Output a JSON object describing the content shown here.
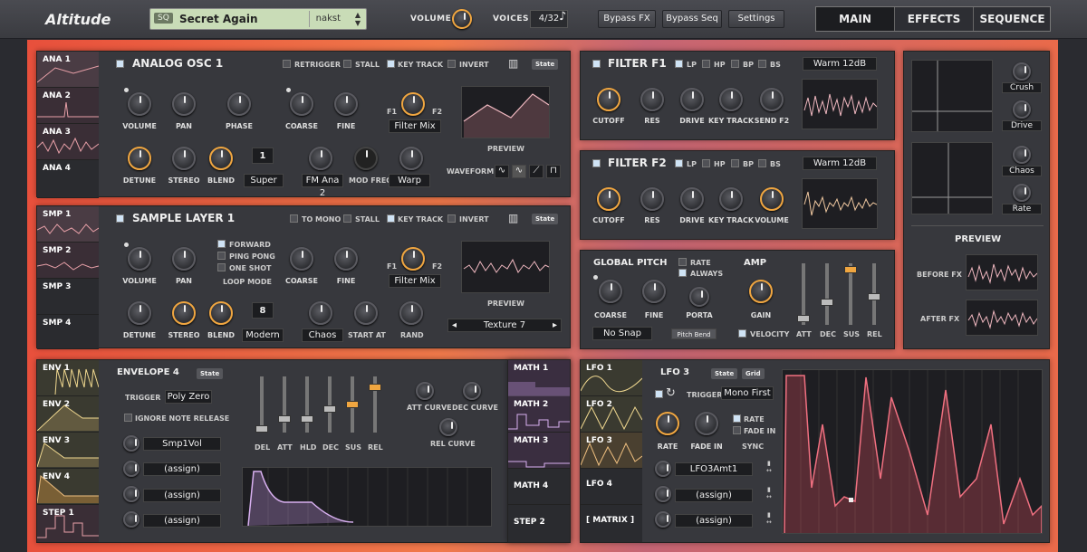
{
  "app": {
    "title": "Altitude"
  },
  "preset": {
    "badge": "SQ",
    "name": "Secret Again",
    "author": "nakst"
  },
  "header": {
    "volume_label": "VOLUME",
    "voices_label": "VOICES",
    "voices_value": "4/32",
    "bypass_fx": "Bypass FX",
    "bypass_seq": "Bypass Seq",
    "settings": "Settings"
  },
  "tabs": [
    {
      "label": "MAIN",
      "active": true
    },
    {
      "label": "EFFECTS"
    },
    {
      "label": "SEQUENCE"
    }
  ],
  "colors": {
    "accent": "#f0a640",
    "bg_gradient_start": "#e8503c",
    "bg_gradient_end": "#ea6a4a",
    "panel": "#37383d",
    "wave": "#e8a0a8"
  },
  "osc": {
    "tabs": [
      "ANA 1",
      "ANA 2",
      "ANA 3",
      "ANA 4"
    ],
    "title": "ANALOG OSC 1",
    "toggles": [
      "RETRIGGER",
      "STALL",
      "KEY TRACK",
      "INVERT"
    ],
    "state": "State",
    "knobs1": [
      "VOLUME",
      "PAN",
      "PHASE",
      "COARSE",
      "FINE"
    ],
    "knobs2": [
      "DETUNE",
      "STEREO",
      "BLEND"
    ],
    "unison": "1",
    "unison_mode": "Super",
    "fm": "FM Ana 2",
    "mod_freq": "MOD FREQ",
    "warp": "Warp",
    "f1": "F1",
    "f2": "F2",
    "filter_mix": "Filter Mix",
    "preview": "PREVIEW",
    "waveform": "WAVEFORM"
  },
  "smp": {
    "tabs": [
      "SMP 1",
      "SMP 2",
      "SMP 3",
      "SMP 4"
    ],
    "title": "SAMPLE LAYER 1",
    "toggles": [
      "TO MONO",
      "STALL",
      "KEY TRACK",
      "INVERT"
    ],
    "state": "State",
    "knobs1": [
      "VOLUME",
      "PAN"
    ],
    "loop": [
      "FORWARD",
      "PING PONG",
      "ONE SHOT"
    ],
    "loop_label": "LOOP MODE",
    "knobs1b": [
      "COARSE",
      "FINE"
    ],
    "knobs2": [
      "DETUNE",
      "STEREO",
      "BLEND"
    ],
    "unison": "8",
    "unison_mode": "Modern",
    "chaos": "Chaos",
    "start_at": "START AT",
    "rand": "RAND",
    "f1": "F1",
    "f2": "F2",
    "filter_mix": "Filter Mix",
    "preview": "PREVIEW",
    "sample": "Texture 7"
  },
  "filter1": {
    "title": "FILTER F1",
    "modes": [
      "LP",
      "HP",
      "BP",
      "BS"
    ],
    "type": "Warm 12dB",
    "knobs": [
      "CUTOFF",
      "RES",
      "DRIVE",
      "KEY TRACK",
      "SEND F2"
    ]
  },
  "filter2": {
    "title": "FILTER F2",
    "modes": [
      "LP",
      "HP",
      "BP",
      "BS"
    ],
    "type": "Warm 12dB",
    "knobs": [
      "CUTOFF",
      "RES",
      "DRIVE",
      "KEY TRACK",
      "VOLUME"
    ]
  },
  "fx": {
    "labels": [
      "Crush",
      "Drive",
      "Chaos",
      "Rate"
    ],
    "preview": "PREVIEW",
    "before": "BEFORE FX",
    "after": "AFTER FX"
  },
  "pitch": {
    "title": "GLOBAL PITCH",
    "rate": "RATE",
    "always": "ALWAYS",
    "knobs": [
      "COARSE",
      "FINE",
      "PORTA"
    ],
    "snap": "No Snap",
    "pitch_bend": "Pitch Bend"
  },
  "amp": {
    "title": "AMP",
    "gain": "GAIN",
    "velocity": "VELOCITY",
    "faders": [
      {
        "label": "ATT",
        "value": 0.05
      },
      {
        "label": "DEC",
        "value": 0.35
      },
      {
        "label": "SUS",
        "value": 0.95
      },
      {
        "label": "REL",
        "value": 0.45
      }
    ]
  },
  "env": {
    "tabs": [
      "ENV 1",
      "ENV 2",
      "ENV 3",
      "ENV 4",
      "STEP 1"
    ],
    "title": "ENVELOPE 4",
    "state": "State",
    "trigger_label": "TRIGGER",
    "trigger": "Poly Zero",
    "ignore": "IGNORE NOTE RELEASE",
    "assign": [
      "Smp1Vol",
      "(assign)",
      "(assign)",
      "(assign)"
    ],
    "faders": [
      {
        "label": "DEL",
        "value": 0.0
      },
      {
        "label": "ATT",
        "value": 0.2
      },
      {
        "label": "HLD",
        "value": 0.2
      },
      {
        "label": "DEC",
        "value": 0.4
      },
      {
        "label": "SUS",
        "value": 0.5
      },
      {
        "label": "REL",
        "value": 0.85
      }
    ],
    "curves": [
      "ATT CURVE",
      "DEC CURVE",
      "REL CURVE"
    ]
  },
  "math": {
    "tabs": [
      "MATH 1",
      "MATH 2",
      "MATH 3",
      "MATH 4",
      "STEP 2"
    ]
  },
  "lfo": {
    "tabs": [
      "LFO 1",
      "LFO 2",
      "LFO 3",
      "LFO 4",
      "[ MATRIX ]"
    ],
    "title": "LFO 3",
    "state": "State",
    "grid": "Grid",
    "trigger_label": "TRIGGER",
    "trigger": "Mono First",
    "knobs": [
      "RATE",
      "FADE IN"
    ],
    "rate": "RATE",
    "fade_in": "FADE IN",
    "sync": "SYNC",
    "assign": [
      "LFO3Amt1",
      "(assign)",
      "(assign)"
    ]
  }
}
